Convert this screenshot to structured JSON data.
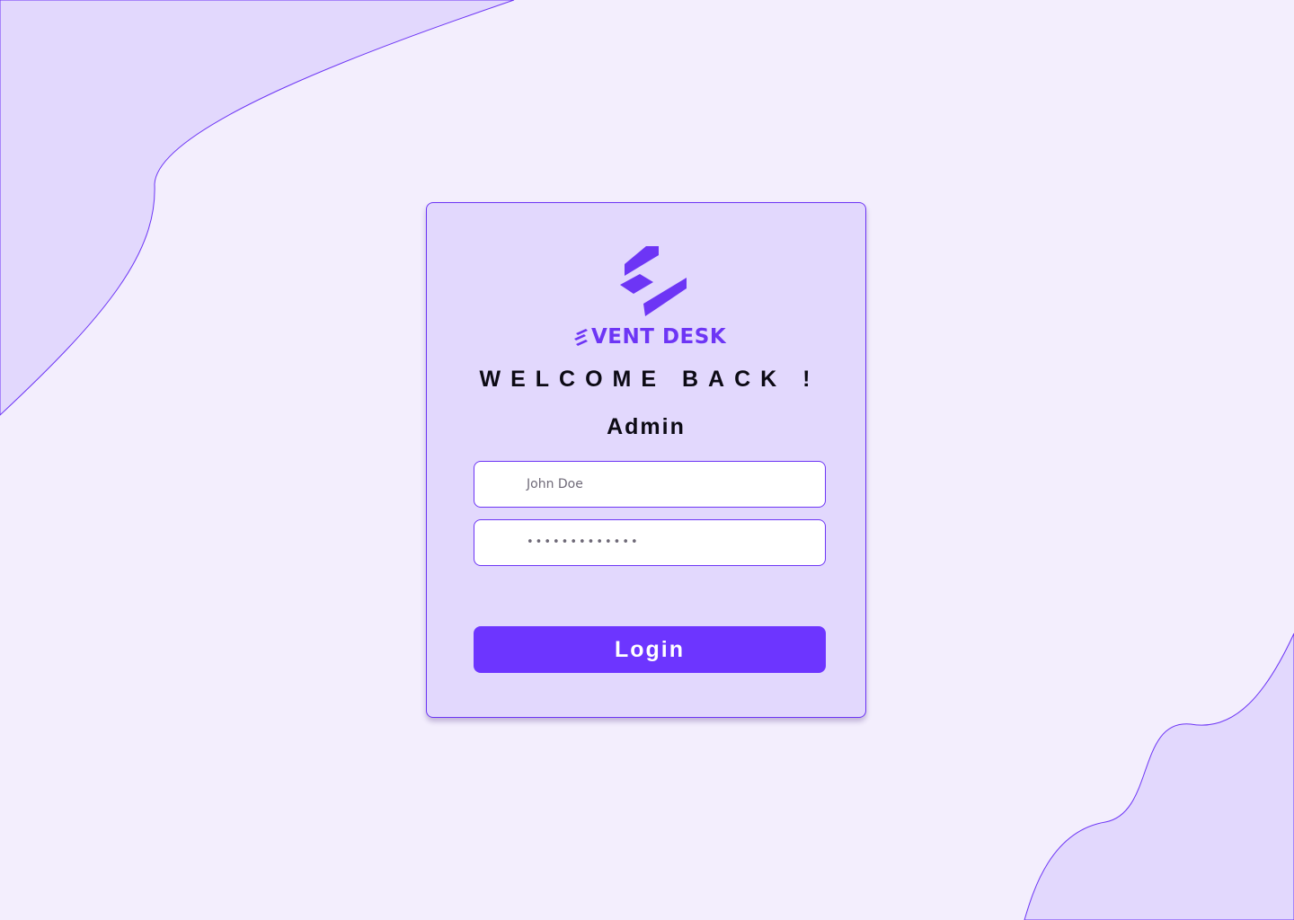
{
  "brand": {
    "name": "VENT DESK",
    "logo": "event-desk-logo",
    "accent_color": "#6d35f5"
  },
  "login": {
    "heading": "WELCOME BACK !",
    "role": "Admin",
    "username": {
      "value": "John Doe"
    },
    "password": {
      "value": "•••••••••••••"
    },
    "button_label": "Login",
    "button_color": "#6d35ff"
  },
  "theme": {
    "background": "#f3eefd",
    "card_background": "#e2d8fd",
    "blob_fill": "#e2d8fd"
  }
}
